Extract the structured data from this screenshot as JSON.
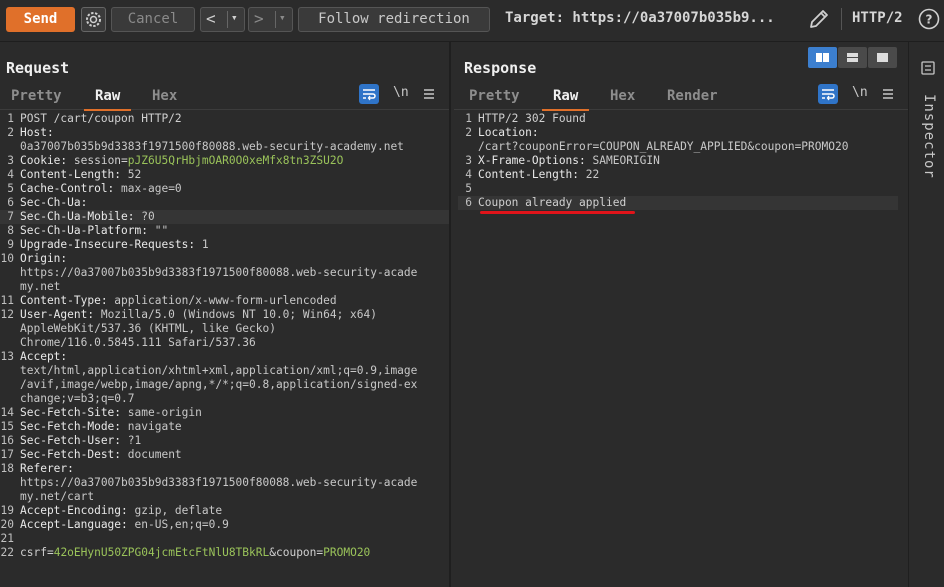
{
  "toolbar": {
    "send_label": "Send",
    "cancel_label": "Cancel",
    "back_label": "<",
    "forward_label": ">",
    "dropdown_glyph": "▾",
    "follow_label": "Follow redirection",
    "target_text": "Target: https://0a37007b035b9...",
    "protocol": "HTTP/2",
    "help_glyph": "?",
    "accent": "#e0702a"
  },
  "request": {
    "title": "Request",
    "tabs": [
      "Pretty",
      "Raw",
      "Hex"
    ],
    "newline_label": "\\n",
    "lines": [
      {
        "n": "1",
        "segs": [
          {
            "t": "POST /cart/coupon HTTP/2",
            "c": "txt"
          }
        ]
      },
      {
        "n": "2",
        "segs": [
          {
            "t": "Host:",
            "c": "key"
          }
        ]
      },
      {
        "n": "",
        "segs": [
          {
            "t": "0a37007b035b9d3383f1971500f80088.web-security-academy.net",
            "c": "val-gray"
          }
        ]
      },
      {
        "n": "3",
        "segs": [
          {
            "t": "Cookie: ",
            "c": "key"
          },
          {
            "t": "session",
            "c": "txt"
          },
          {
            "t": "=",
            "c": "txt"
          },
          {
            "t": "pJZ6U5QrHbjmOAR0O0xeMfx8tn3ZSU2O",
            "c": "val-green"
          }
        ]
      },
      {
        "n": "4",
        "segs": [
          {
            "t": "Content-Length: ",
            "c": "key"
          },
          {
            "t": "52",
            "c": "val-gray"
          }
        ]
      },
      {
        "n": "5",
        "segs": [
          {
            "t": "Cache-Control: ",
            "c": "key"
          },
          {
            "t": "max-age=0",
            "c": "val-gray"
          }
        ]
      },
      {
        "n": "6",
        "segs": [
          {
            "t": "Sec-Ch-Ua:",
            "c": "key"
          }
        ]
      },
      {
        "n": "7",
        "segs": [
          {
            "t": "Sec-Ch-Ua-Mobile: ",
            "c": "key"
          },
          {
            "t": "?0",
            "c": "val-gray"
          }
        ],
        "hl": true
      },
      {
        "n": "8",
        "segs": [
          {
            "t": "Sec-Ch-Ua-Platform: ",
            "c": "key"
          },
          {
            "t": "\"\"",
            "c": "val-gray"
          }
        ]
      },
      {
        "n": "9",
        "segs": [
          {
            "t": "Upgrade-Insecure-Requests: ",
            "c": "key"
          },
          {
            "t": "1",
            "c": "val-gray"
          }
        ]
      },
      {
        "n": "10",
        "segs": [
          {
            "t": "Origin:",
            "c": "key"
          }
        ]
      },
      {
        "n": "",
        "segs": [
          {
            "t": "https://0a37007b035b9d3383f1971500f80088.web-security-acade",
            "c": "val-gray"
          }
        ]
      },
      {
        "n": "",
        "segs": [
          {
            "t": "my.net",
            "c": "val-gray"
          }
        ]
      },
      {
        "n": "11",
        "segs": [
          {
            "t": "Content-Type: ",
            "c": "key"
          },
          {
            "t": "application/x-www-form-urlencoded",
            "c": "val-gray"
          }
        ]
      },
      {
        "n": "12",
        "segs": [
          {
            "t": "User-Agent: ",
            "c": "key"
          },
          {
            "t": "Mozilla/5.0 (Windows NT 10.0; Win64; x64)",
            "c": "val-gray"
          }
        ]
      },
      {
        "n": "",
        "segs": [
          {
            "t": "AppleWebKit/537.36 (KHTML, like Gecko)",
            "c": "val-gray"
          }
        ]
      },
      {
        "n": "",
        "segs": [
          {
            "t": "Chrome/116.0.5845.111 Safari/537.36",
            "c": "val-gray"
          }
        ]
      },
      {
        "n": "13",
        "segs": [
          {
            "t": "Accept:",
            "c": "key"
          }
        ]
      },
      {
        "n": "",
        "segs": [
          {
            "t": "text/html,application/xhtml+xml,application/xml;q=0.9,image",
            "c": "val-gray"
          }
        ]
      },
      {
        "n": "",
        "segs": [
          {
            "t": "/avif,image/webp,image/apng,*/*;q=0.8,application/signed-ex",
            "c": "val-gray"
          }
        ]
      },
      {
        "n": "",
        "segs": [
          {
            "t": "change;v=b3;q=0.7",
            "c": "val-gray"
          }
        ]
      },
      {
        "n": "14",
        "segs": [
          {
            "t": "Sec-Fetch-Site: ",
            "c": "key"
          },
          {
            "t": "same-origin",
            "c": "val-gray"
          }
        ]
      },
      {
        "n": "15",
        "segs": [
          {
            "t": "Sec-Fetch-Mode: ",
            "c": "key"
          },
          {
            "t": "navigate",
            "c": "val-gray"
          }
        ]
      },
      {
        "n": "16",
        "segs": [
          {
            "t": "Sec-Fetch-User: ",
            "c": "key"
          },
          {
            "t": "?1",
            "c": "val-gray"
          }
        ]
      },
      {
        "n": "17",
        "segs": [
          {
            "t": "Sec-Fetch-Dest: ",
            "c": "key"
          },
          {
            "t": "document",
            "c": "val-gray"
          }
        ]
      },
      {
        "n": "18",
        "segs": [
          {
            "t": "Referer:",
            "c": "key"
          }
        ]
      },
      {
        "n": "",
        "segs": [
          {
            "t": "https://0a37007b035b9d3383f1971500f80088.web-security-acade",
            "c": "val-gray"
          }
        ]
      },
      {
        "n": "",
        "segs": [
          {
            "t": "my.net/cart",
            "c": "val-gray"
          }
        ]
      },
      {
        "n": "19",
        "segs": [
          {
            "t": "Accept-Encoding: ",
            "c": "key"
          },
          {
            "t": "gzip, deflate",
            "c": "val-gray"
          }
        ]
      },
      {
        "n": "20",
        "segs": [
          {
            "t": "Accept-Language: ",
            "c": "key"
          },
          {
            "t": "en-US,en;q=0.9",
            "c": "val-gray"
          }
        ]
      },
      {
        "n": "21",
        "segs": []
      },
      {
        "n": "22",
        "segs": [
          {
            "t": "csrf",
            "c": "txt"
          },
          {
            "t": "=",
            "c": "txt"
          },
          {
            "t": "42oEHynU50ZPG04jcmEtcFtNlU8TBkRL",
            "c": "val-green"
          },
          {
            "t": "&coupon=",
            "c": "txt"
          },
          {
            "t": "PROMO20",
            "c": "val-green"
          }
        ]
      }
    ]
  },
  "response": {
    "title": "Response",
    "tabs": [
      "Pretty",
      "Raw",
      "Hex",
      "Render"
    ],
    "newline_label": "\\n",
    "lines": [
      {
        "n": "1",
        "segs": [
          {
            "t": "HTTP/2 302 Found",
            "c": "txt"
          }
        ]
      },
      {
        "n": "2",
        "segs": [
          {
            "t": "Location:",
            "c": "key"
          }
        ]
      },
      {
        "n": "",
        "segs": [
          {
            "t": "/cart?couponError=COUPON_ALREADY_APPLIED&coupon=PROMO20",
            "c": "val-gray"
          }
        ]
      },
      {
        "n": "3",
        "segs": [
          {
            "t": "X-Frame-Options: ",
            "c": "key"
          },
          {
            "t": "SAMEORIGIN",
            "c": "val-gray"
          }
        ]
      },
      {
        "n": "4",
        "segs": [
          {
            "t": "Content-Length: ",
            "c": "key"
          },
          {
            "t": "22",
            "c": "val-gray"
          }
        ]
      },
      {
        "n": "5",
        "segs": []
      },
      {
        "n": "6",
        "segs": [
          {
            "t": "Coupon already applied",
            "c": "txt"
          }
        ],
        "hl": true
      }
    ]
  },
  "inspector": {
    "label": "Inspector"
  }
}
